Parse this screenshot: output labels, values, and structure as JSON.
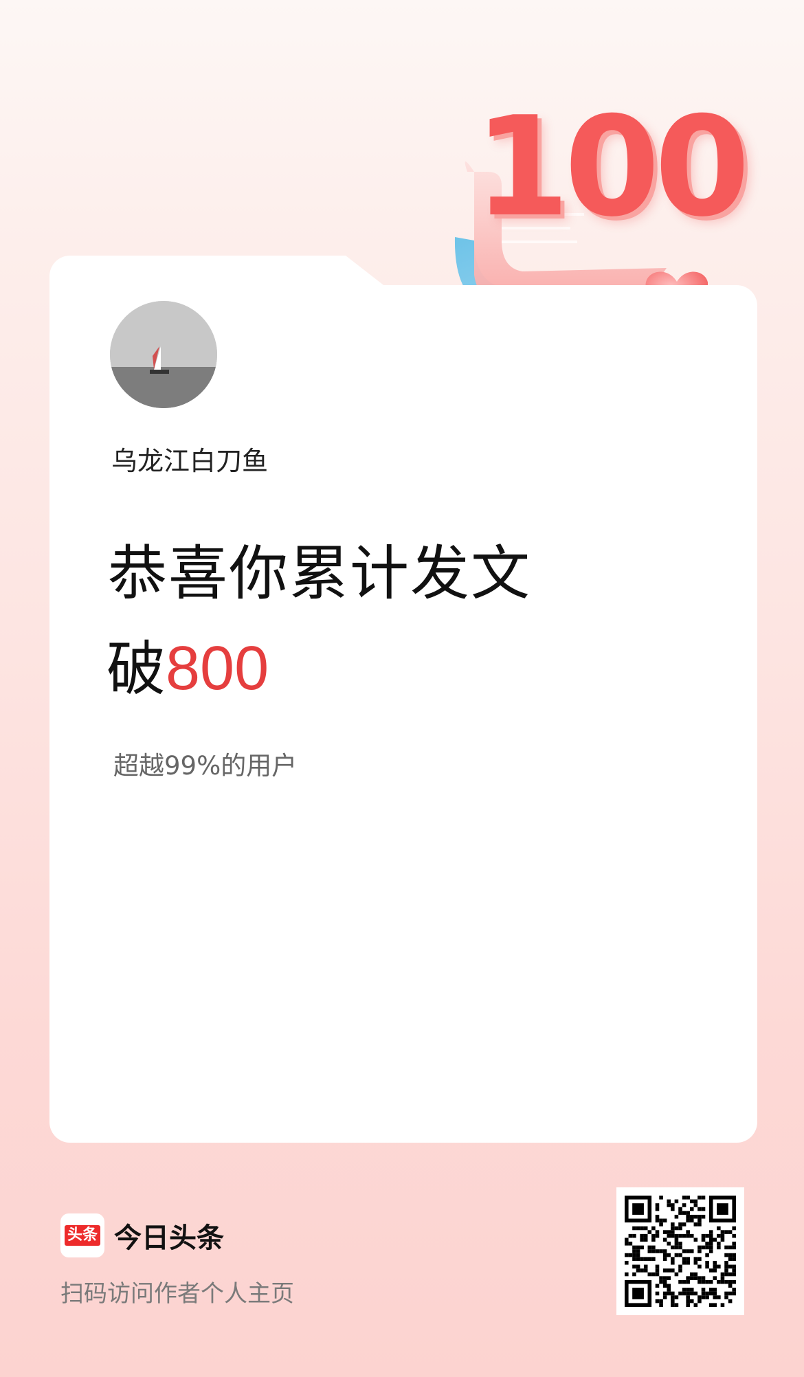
{
  "badge": {
    "number": "100"
  },
  "user": {
    "name": "乌龙江白刀鱼"
  },
  "headline": {
    "line1": "恭喜你累计发文",
    "line2_prefix": "破",
    "line2_count": "800"
  },
  "subtext": "超越99%的用户",
  "footer": {
    "logo_text": "头条",
    "brand_name": "今日头条",
    "scan_tip": "扫码访问作者个人主页"
  },
  "colors": {
    "accent": "#e53e3e",
    "brand_red": "#ed2b2b"
  }
}
